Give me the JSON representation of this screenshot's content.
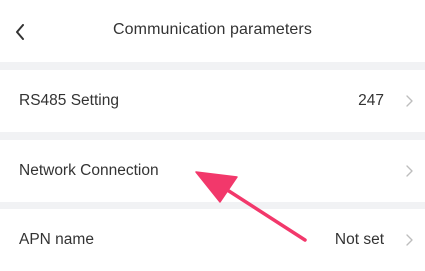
{
  "header": {
    "title": "Communication parameters",
    "back_icon": "chevron-left-icon"
  },
  "rows": [
    {
      "label": "RS485 Setting",
      "value": "247"
    },
    {
      "label": "Network Connection",
      "value": ""
    },
    {
      "label": "APN name",
      "value": "Not set"
    }
  ],
  "icons": {
    "row_chevron": "chevron-right-icon",
    "annotation": "pointer-arrow"
  },
  "colors": {
    "background": "#ffffff",
    "separator": "#f1f2f4",
    "text": "#333333",
    "chevron": "#bdbdbd",
    "annotation_arrow": "#f2386b"
  }
}
